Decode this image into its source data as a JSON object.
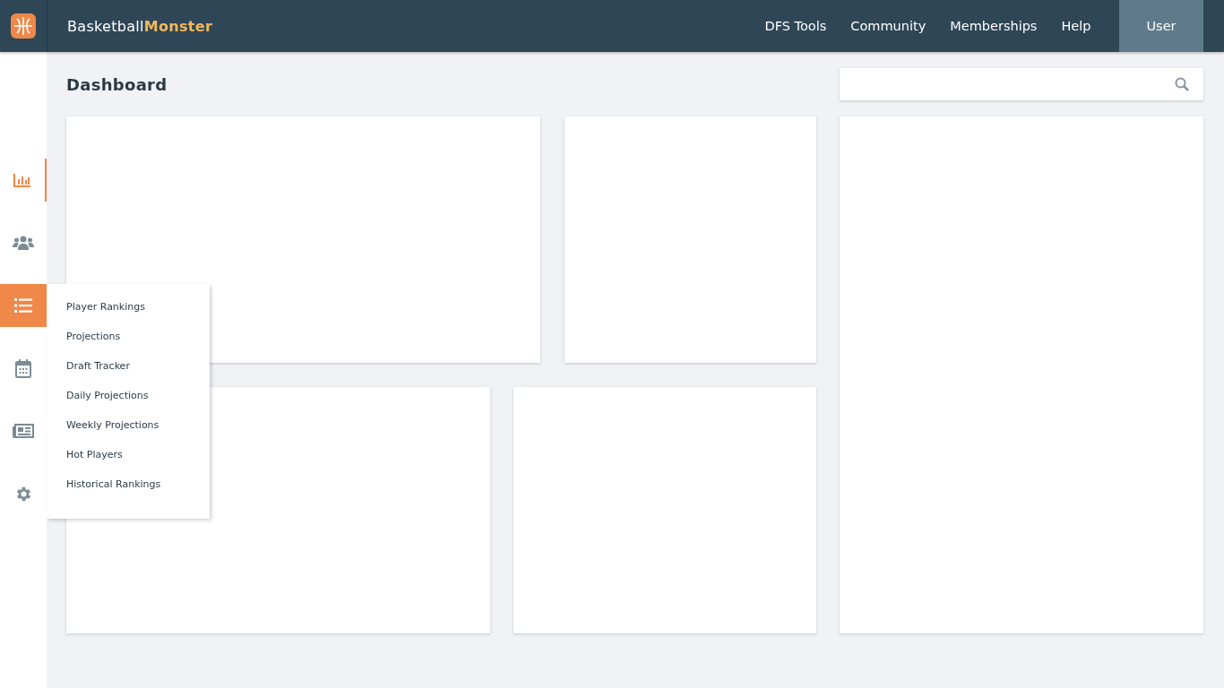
{
  "header": {
    "brand": {
      "first": "Basketball",
      "second": "Monster"
    },
    "nav": [
      {
        "label": "DFS Tools",
        "selected": false
      },
      {
        "label": "Community",
        "selected": false
      },
      {
        "label": "Memberships",
        "selected": false
      },
      {
        "label": "Help",
        "selected": false
      },
      {
        "label": "User",
        "selected": true
      }
    ]
  },
  "sidebar": {
    "items": [
      {
        "kind": "chart",
        "selected": true,
        "expanded": false
      },
      {
        "kind": "users",
        "selected": false,
        "expanded": false
      },
      {
        "kind": "list",
        "selected": false,
        "expanded": true,
        "menu": [
          "Player Rankings",
          "Projections",
          "Draft Tracker",
          "Daily Projections",
          "Weekly Projections",
          "Hot Players",
          "Historical Rankings"
        ]
      },
      {
        "kind": "calendar",
        "selected": false,
        "expanded": false
      },
      {
        "kind": "news",
        "selected": false,
        "expanded": false
      },
      {
        "kind": "settings",
        "selected": false,
        "expanded": false
      }
    ]
  },
  "page": {
    "title": "Dashboard"
  }
}
